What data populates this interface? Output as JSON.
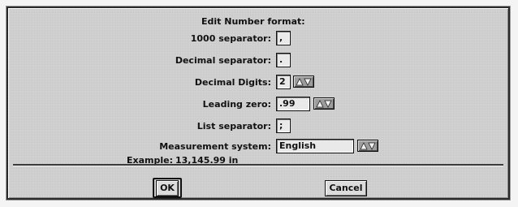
{
  "dialog": {
    "title": "Edit Number format:",
    "thousand_separator": {
      "label": "1000 separator:",
      "value": ","
    },
    "decimal_separator": {
      "label": "Decimal separator:",
      "value": "."
    },
    "decimal_digits": {
      "label": "Decimal Digits:",
      "value": "2",
      "stepper_icon": "up-down-arrows-icon"
    },
    "leading_zero": {
      "label": "Leading zero:",
      "value": ".99",
      "stepper_icon": "up-down-arrows-icon"
    },
    "list_separator": {
      "label": "List separator:",
      "value": ";"
    },
    "measurement_system": {
      "label": "Measurement system:",
      "value": "English",
      "stepper_icon": "up-down-arrows-icon"
    },
    "example": {
      "label": "Example:",
      "value": "13,145.99 in"
    },
    "ok_label": "OK",
    "cancel_label": "Cancel"
  }
}
